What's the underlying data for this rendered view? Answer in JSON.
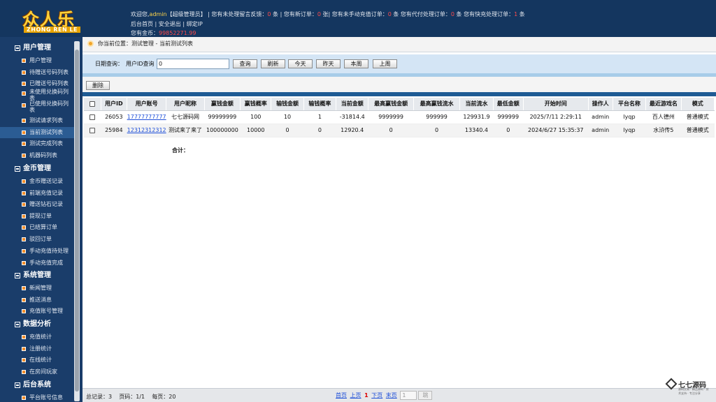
{
  "logo": {
    "main": "众人乐",
    "sub": "ZHONG REN LE"
  },
  "header": {
    "line1": [
      {
        "t": "欢迎您,",
        "c": ""
      },
      {
        "t": "admin",
        "c": "y"
      },
      {
        "t": "【超级管理员】 | 您有未处理留言反馈：",
        "c": ""
      },
      {
        "t": "0",
        "c": "r"
      },
      {
        "t": " 条 | 您有新订单：",
        "c": ""
      },
      {
        "t": "0",
        "c": "r"
      },
      {
        "t": " 张| 您有未手动充值订单：",
        "c": ""
      },
      {
        "t": "0",
        "c": "r"
      },
      {
        "t": " 条 您有代付处理订单：",
        "c": ""
      },
      {
        "t": "0",
        "c": "r"
      },
      {
        "t": " 条 您有快充处理订单：",
        "c": ""
      },
      {
        "t": "1",
        "c": "r"
      },
      {
        "t": " 条",
        "c": ""
      }
    ],
    "links": [
      "后台首页",
      "安全退出",
      "绑定IP"
    ],
    "gold_label": "您有金币：",
    "gold_value": "99852271.99"
  },
  "sidebar": {
    "groups": [
      {
        "title": "用户管理",
        "items": [
          "用户管理",
          "待赠送号码列表",
          "已赠送号码列表",
          "未使用兑换码列表",
          "已使用兑换码列表",
          "测试请求列表",
          "当前测试列表",
          "测试完成列表",
          "机器码列表"
        ]
      },
      {
        "title": "金币管理",
        "items": [
          "金币赠送记录",
          "前端充值记录",
          "赠送钻石记录",
          "提现订单",
          "已结算订单",
          "驳回订单",
          "手动充值待处理",
          "手动充值完成"
        ]
      },
      {
        "title": "系统管理",
        "items": [
          "新闻管理",
          "推送消息",
          "充值账号管理"
        ]
      },
      {
        "title": "数据分析",
        "items": [
          "充值统计",
          "注册统计",
          "在线统计",
          "在房间玩家"
        ]
      },
      {
        "title": "后台系统",
        "items": [
          "平台账号信息"
        ]
      }
    ],
    "active": "当前测试列表"
  },
  "breadcrumb": "你当前位置：测试管理 - 当前测试列表",
  "search": {
    "date_label": "日期查询：",
    "uid_label": "用户ID查询",
    "uid_value": "0",
    "buttons": [
      "查询",
      "刷新",
      "今天",
      "昨天",
      "本周",
      "上周"
    ]
  },
  "actions": {
    "delete": "删除"
  },
  "table": {
    "headers": [
      "用户ID",
      "用户账号",
      "用户昵称",
      "赢钱金额",
      "赢钱概率",
      "输钱金额",
      "输钱概率",
      "当前金额",
      "最高赢钱金额",
      "最高赢钱流水",
      "当前流水",
      "最低金额",
      "开始时间",
      "操作人",
      "平台名称",
      "最近游戏名",
      "模式"
    ],
    "rows": [
      [
        "26053",
        "17777777777",
        "七七源码网",
        "99999999",
        "100",
        "10",
        "1",
        "-31814.4",
        "9999999",
        "999999",
        "129931.9",
        "999999",
        "2025/7/11 2:29:11",
        "admin",
        "lyqp",
        "百人德州",
        "普通模式"
      ],
      [
        "25984",
        "12312312312",
        "测试来了来了",
        "100000000",
        "10000",
        "0",
        "0",
        "12920.4",
        "0",
        "0",
        "13340.4",
        "0",
        "2024/6/27 15:35:37",
        "admin",
        "lyqp",
        "水浒传5",
        "普通模式"
      ]
    ],
    "total_label": "合计："
  },
  "footer": {
    "total": "总记录：3",
    "pages": "页码：1/1",
    "per_page": "每页：20",
    "first": "首页",
    "prev": "上页",
    "current": "1",
    "next": "下页",
    "last": "末页",
    "page_input": "1",
    "go": "跳"
  },
  "watermark": {
    "title": "七七源码",
    "sub": "源码交易 · 精品源码 · 技术支持 · 专注分享"
  },
  "colors": {
    "header_bg": "#14365f",
    "sidebar_bg": "#1a3d6a",
    "active_bg": "#2b5c93",
    "search_bg": "#d4e5f5",
    "table_band": "#1e5b94",
    "link": "#1d4ed8",
    "alert": "#ff4b4b"
  }
}
